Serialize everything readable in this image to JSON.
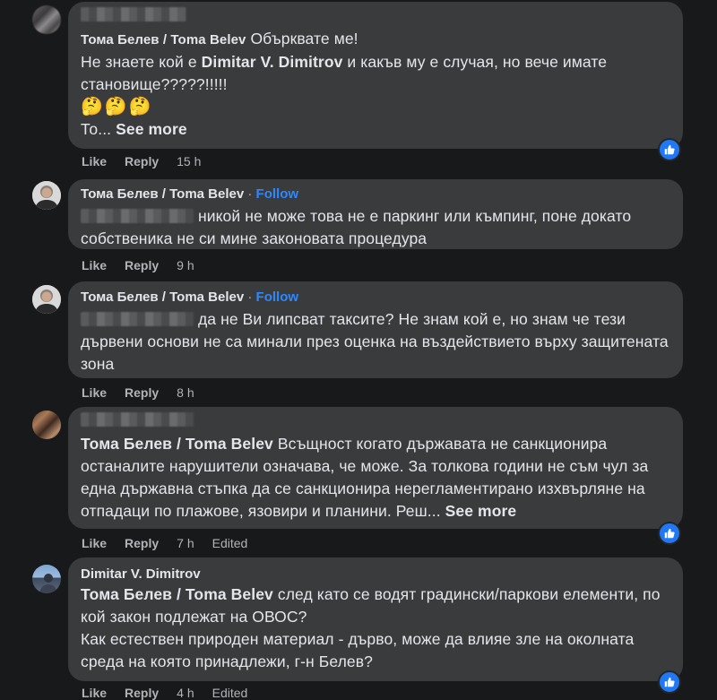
{
  "comments": [
    {
      "author": "Тома Белев / Toma Belev",
      "reply_to_blurred": true,
      "lines": [
        "Обърквате ме!",
        "Не знаете кой е ",
        "Dimitar V. Dimitrov",
        " и какъв му е случая, но вече имате становище?????!!!!!",
        "🤔🤔🤔",
        "То... ",
        "See more"
      ],
      "actions": {
        "like": "Like",
        "reply": "Reply",
        "time": "15 h"
      }
    },
    {
      "author": "Тома Белев / Toma Belev",
      "follow": "Follow",
      "text": "никой не може това не е паркинг или къмпинг, поне докато собственика не си мине законовата процедура",
      "actions": {
        "like": "Like",
        "reply": "Reply",
        "time": "9 h"
      }
    },
    {
      "author": "Тома Белев / Toma Belev",
      "follow": "Follow",
      "text": "да не Ви липсват таксите? Не знам кой е, но знам че тези дървени основи не са минали през оценка на въздействието върху защитената зона",
      "actions": {
        "like": "Like",
        "reply": "Reply",
        "time": "8 h"
      }
    },
    {
      "mention": "Тома Белев / Toma Belev",
      "text": "Всъщност когато държавата не санкционира останалите нарушители означава, че може. За толкова години не съм чул за една държавна стъпка да се санкционира нерегламентирано изхвърляне на отпадаци по плажове, язовири и планини. Реш... ",
      "see_more": "See more",
      "actions": {
        "like": "Like",
        "reply": "Reply",
        "time": "7 h",
        "edited": "Edited"
      }
    },
    {
      "author": "Dimitar V. Dimitrov",
      "mention": "Тома Белев / Toma Belev",
      "text": "след като се водят градински/паркови елементи, по кой закон подлежат на ОВОС?",
      "text2": "Как естествен природен материал - дърво, може да влияе зле на околната среда на която принадлежи, г-н Белев?",
      "actions": {
        "like": "Like",
        "reply": "Reply",
        "time": "4 h",
        "edited": "Edited"
      }
    }
  ]
}
